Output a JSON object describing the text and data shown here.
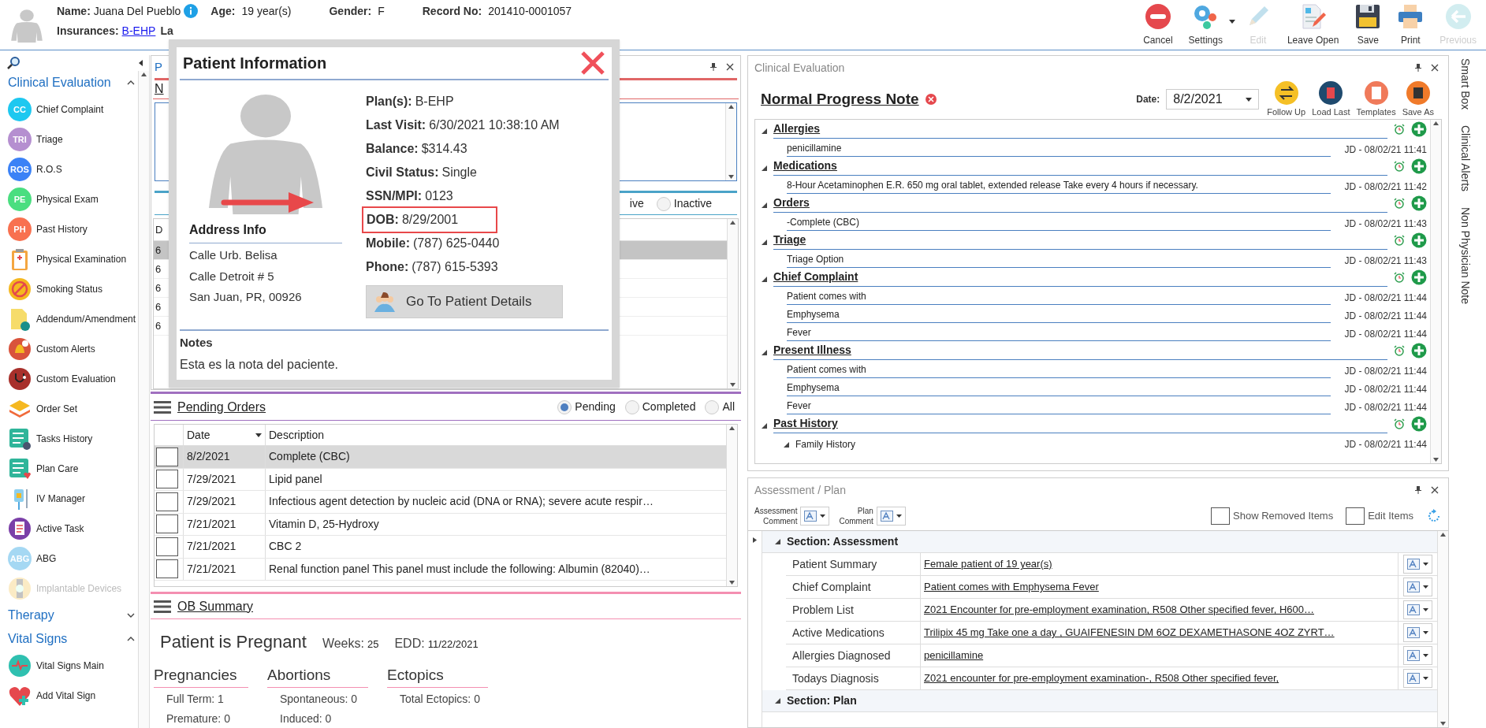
{
  "header": {
    "name_label": "Name:",
    "name": "Juana Del Pueblo",
    "age_label": "Age:",
    "age": "19 year(s)",
    "gender_label": "Gender:",
    "gender": "F",
    "record_label": "Record No:",
    "record": "201410-0001057",
    "insurance_label": "Insurances:",
    "insurance": "B-EHP",
    "covered_fragment": "La"
  },
  "toolbar": [
    {
      "label": "Cancel",
      "kind": "cancel",
      "disabled": false
    },
    {
      "label": "Settings",
      "kind": "settings",
      "disabled": false
    },
    {
      "label": "Edit",
      "kind": "edit",
      "disabled": true
    },
    {
      "label": "Leave Open",
      "kind": "leave_open",
      "disabled": false
    },
    {
      "label": "Save",
      "kind": "save",
      "disabled": false
    },
    {
      "label": "Print",
      "kind": "print",
      "disabled": false
    },
    {
      "label": "Previous",
      "kind": "previous",
      "disabled": true
    }
  ],
  "sidebar": {
    "sections": [
      {
        "title": "Clinical Evaluation",
        "expanded": true,
        "items": [
          {
            "label": "Chief Complaint",
            "kind": "badge",
            "badge": "CC",
            "color": "#1ec8f0",
            "disabled": false
          },
          {
            "label": "Triage",
            "kind": "badge",
            "badge": "TRI",
            "color": "#b58fd0",
            "disabled": false
          },
          {
            "label": "R.O.S",
            "kind": "badge",
            "badge": "ROS",
            "color": "#3b82f6",
            "disabled": false
          },
          {
            "label": "Physical Exam",
            "kind": "badge",
            "badge": "PE",
            "color": "#4ade80",
            "disabled": false
          },
          {
            "label": "Past History",
            "kind": "badge",
            "badge": "PH",
            "color": "#f87150",
            "disabled": false
          },
          {
            "label": "Physical Examination",
            "kind": "clipboard",
            "disabled": false
          },
          {
            "label": "Smoking Status",
            "kind": "smoking",
            "disabled": false
          },
          {
            "label": "Addendum/Amendment",
            "kind": "note",
            "disabled": false
          },
          {
            "label": "Custom Alerts",
            "kind": "bell",
            "disabled": false
          },
          {
            "label": "Custom Evaluation",
            "kind": "stethoscope",
            "disabled": false
          },
          {
            "label": "Order Set",
            "kind": "layers",
            "disabled": false
          },
          {
            "label": "Tasks History",
            "kind": "tasks",
            "disabled": false
          },
          {
            "label": "Plan Care",
            "kind": "plan",
            "disabled": false
          },
          {
            "label": "IV Manager",
            "kind": "iv",
            "disabled": false
          },
          {
            "label": "Active Task",
            "kind": "active",
            "disabled": false
          },
          {
            "label": "ABG",
            "kind": "badge",
            "badge": "ABG",
            "color": "#a5d8f3",
            "disabled": false
          },
          {
            "label": "Implantable Devices",
            "kind": "watch",
            "disabled": true
          }
        ]
      },
      {
        "title": "Therapy",
        "expanded": false
      },
      {
        "title": "Vital Signs",
        "expanded": true,
        "items": [
          {
            "label": "Vital Signs Main",
            "kind": "heartwave",
            "disabled": false
          },
          {
            "label": "Add Vital Sign",
            "kind": "heartplus",
            "disabled": false
          }
        ]
      }
    ]
  },
  "background_panel": {
    "tab_fragment": "P",
    "section_fragment": "N",
    "column_fragment": "D",
    "row_fragments": [
      {
        "text": "6",
        "selected": true
      },
      {
        "text": "6",
        "selected": false
      },
      {
        "text": "6",
        "selected": false
      },
      {
        "text": "6",
        "selected": false
      },
      {
        "text": "6",
        "selected": false
      }
    ],
    "radio_fragment": "ive",
    "radio": {
      "label": "Inactive",
      "selected": false
    }
  },
  "popup": {
    "title": "Patient Information",
    "fields": [
      {
        "label": "Plan(s):",
        "value": "B-EHP",
        "highlighted": false
      },
      {
        "label": "Last Visit:",
        "value": "6/30/2021 10:38:10 AM",
        "highlighted": false
      },
      {
        "label": "Balance:",
        "value": "$314.43",
        "highlighted": false
      },
      {
        "label": "Civil Status:",
        "value": "Single",
        "highlighted": false
      },
      {
        "label": "SSN/MPI:",
        "value": "0123",
        "highlighted": false
      },
      {
        "label": "DOB:",
        "value": "8/29/2001",
        "highlighted": true
      },
      {
        "label": "Mobile:",
        "value": "(787) 625-0440",
        "highlighted": false
      },
      {
        "label": "Phone:",
        "value": "(787) 615-5393",
        "highlighted": false
      }
    ],
    "address_title": "Address Info",
    "address_lines": [
      "Calle Urb. Belisa",
      "Calle Detroit # 5",
      "San Juan, PR, 00926"
    ],
    "button": "Go To Patient Details",
    "notes_title": "Notes",
    "notes": "Esta es la nota del paciente."
  },
  "pending_orders": {
    "title": "Pending Orders",
    "filters": [
      {
        "label": "Pending",
        "selected": true
      },
      {
        "label": "Completed",
        "selected": false
      },
      {
        "label": "All",
        "selected": false
      }
    ],
    "columns": [
      "Date",
      "Description"
    ],
    "rows": [
      {
        "date": "8/2/2021",
        "description": "Complete (CBC)",
        "selected": true,
        "checked": false
      },
      {
        "date": "7/29/2021",
        "description": "Lipid panel",
        "selected": false,
        "checked": false
      },
      {
        "date": "7/29/2021",
        "description": "Infectious agent detection by nucleic acid (DNA or RNA); severe acute respir…",
        "selected": false,
        "checked": false
      },
      {
        "date": "7/21/2021",
        "description": "Vitamin D, 25-Hydroxy",
        "selected": false,
        "checked": false
      },
      {
        "date": "7/21/2021",
        "description": "CBC 2",
        "selected": false,
        "checked": false
      },
      {
        "date": "7/21/2021",
        "description": "Renal function panel This panel must include the following: Albumin (82040)…",
        "selected": false,
        "checked": false
      }
    ]
  },
  "ob_summary": {
    "title": "OB Summary",
    "status": "Patient is Pregnant",
    "weeks_label": "Weeks:",
    "weeks": "25",
    "edd_label": "EDD:",
    "edd": "11/22/2021",
    "groups": [
      {
        "title": "Pregnancies",
        "lines": [
          "Full Term: 1",
          "Premature: 0"
        ]
      },
      {
        "title": "Abortions",
        "lines": [
          "Spontaneous: 0",
          "Induced: 0"
        ]
      },
      {
        "title": "Ectopics",
        "lines": [
          "Total Ectopics: 0"
        ]
      }
    ]
  },
  "clinical_evaluation": {
    "panel_title": "Clinical Evaluation",
    "note_title": "Normal Progress Note",
    "date_label": "Date:",
    "date": "8/2/2021",
    "actions": [
      {
        "label": "Follow Up",
        "kind": "follow_up"
      },
      {
        "label": "Load Last",
        "kind": "load_last"
      },
      {
        "label": "Templates",
        "kind": "templates"
      },
      {
        "label": "Save As",
        "kind": "save_as"
      }
    ],
    "sections": [
      {
        "title": "Allergies",
        "expanded": true,
        "entries": [
          {
            "text": "penicillamine",
            "meta": "JD - 08/02/21 11:41"
          }
        ]
      },
      {
        "title": "Medications",
        "expanded": true,
        "entries": [
          {
            "text": "8-Hour Acetaminophen E.R. 650 mg oral tablet, extended release Take every 4 hours if necessary.",
            "meta": "JD - 08/02/21 11:42"
          }
        ]
      },
      {
        "title": "Orders",
        "expanded": true,
        "entries": [
          {
            "text": "-Complete (CBC)",
            "meta": "JD - 08/02/21 11:43"
          }
        ]
      },
      {
        "title": "Triage",
        "expanded": true,
        "entries": [
          {
            "text": "Triage Option",
            "meta": "JD - 08/02/21 11:43"
          }
        ]
      },
      {
        "title": "Chief Complaint",
        "expanded": true,
        "entries": [
          {
            "text": "Patient comes with",
            "meta": "JD - 08/02/21 11:44"
          },
          {
            "text": "Emphysema",
            "meta": "JD - 08/02/21 11:44"
          },
          {
            "text": "Fever",
            "meta": "JD - 08/02/21 11:44"
          }
        ]
      },
      {
        "title": "Present Illness",
        "expanded": true,
        "entries": [
          {
            "text": "Patient comes with",
            "meta": "JD - 08/02/21 11:44"
          },
          {
            "text": "Emphysema",
            "meta": "JD - 08/02/21 11:44"
          },
          {
            "text": "Fever",
            "meta": "JD - 08/02/21 11:44"
          }
        ]
      },
      {
        "title": "Past History",
        "expanded": true,
        "entries": [
          {
            "text": "Family History",
            "meta": "JD - 08/02/21 11:44",
            "kind": "subsection"
          }
        ]
      }
    ]
  },
  "assessment_plan": {
    "panel_title": "Assessment / Plan",
    "comment_buttons": [
      {
        "lines": [
          "Assessment",
          "Comment"
        ]
      },
      {
        "lines": [
          "Plan",
          "Comment"
        ]
      }
    ],
    "checkboxes": [
      {
        "label": "Show Removed Items",
        "checked": false
      },
      {
        "label": "Edit Items",
        "checked": false
      }
    ],
    "sections": [
      {
        "title": "Section: Assessment",
        "expanded": true,
        "rows": [
          {
            "label": "Patient Summary",
            "value": "Female patient of 19 year(s)"
          },
          {
            "label": "Chief Complaint",
            "value": "Patient comes with  Emphysema  Fever "
          },
          {
            "label": "Problem List",
            "value": "Z021 Encounter for pre-employment examination, R508 Other specified fever, H600…"
          },
          {
            "label": "Active Medications",
            "value": "Trilipix 45 mg Take one a day , GUAIFENESIN DM 6OZ  DEXAMETHASONE 4OZ  ZYRT…"
          },
          {
            "label": "Allergies Diagnosed",
            "value": "penicillamine"
          },
          {
            "label": "Todays Diagnosis",
            "value": "Z021 encounter for pre-employment examination-,  R508 Other specified fever,"
          }
        ]
      },
      {
        "title": "Section: Plan",
        "expanded": true
      }
    ]
  },
  "side_tabs": [
    "Smart Box",
    "Clinical Alerts",
    "Non Physician Note"
  ]
}
